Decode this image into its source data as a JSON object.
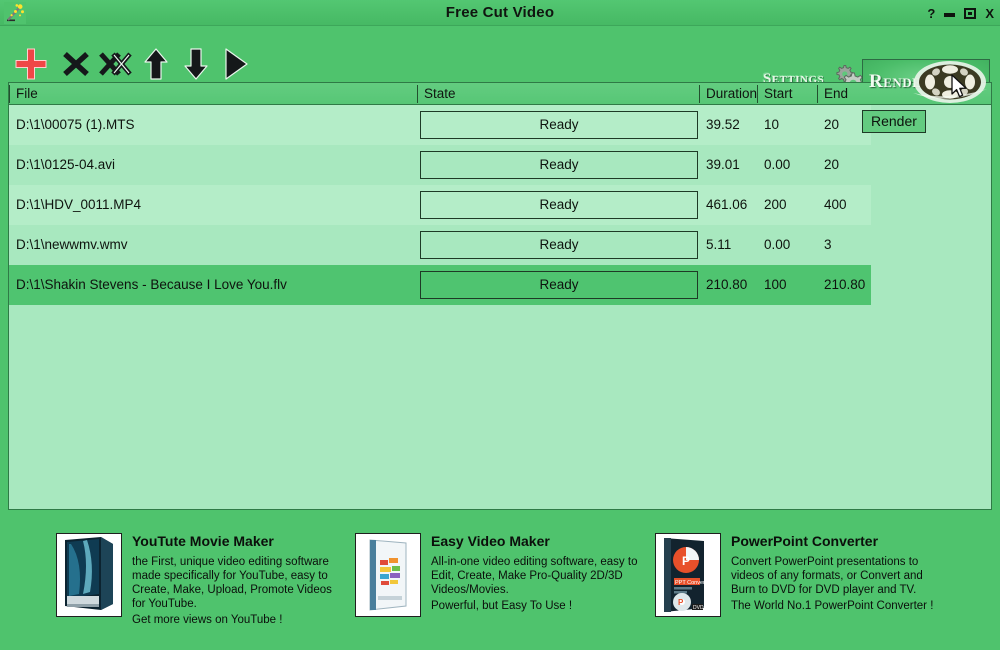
{
  "window": {
    "title": "Free Cut Video",
    "app_icon": "magic-wand-icon",
    "controls": {
      "help": "?",
      "minimize": "minimize",
      "maximize": "maximize",
      "close": "X"
    }
  },
  "toolbar": {
    "items": [
      {
        "name": "add-file-button",
        "icon": "plus-icon",
        "tip": "Add"
      },
      {
        "name": "remove-file-button",
        "icon": "close-x-icon",
        "tip": "Remove"
      },
      {
        "name": "remove-all-button",
        "icon": "double-x-icon",
        "tip": "Remove All"
      },
      {
        "name": "move-up-button",
        "icon": "arrow-up-icon",
        "tip": "Move Up"
      },
      {
        "name": "move-down-button",
        "icon": "arrow-down-icon",
        "tip": "Move Down"
      },
      {
        "name": "play-button",
        "icon": "play-triangle-icon",
        "tip": "Play"
      }
    ],
    "settings_label": "Settings",
    "render_label": "Render",
    "render_tooltip": "Render"
  },
  "list": {
    "columns": [
      {
        "key": "file",
        "label": "File"
      },
      {
        "key": "state",
        "label": "State"
      },
      {
        "key": "duration",
        "label": "Duration"
      },
      {
        "key": "start",
        "label": "Start"
      },
      {
        "key": "end",
        "label": "End"
      }
    ],
    "rows": [
      {
        "file": "D:\\1\\00075 (1).MTS",
        "state": "Ready",
        "duration": "39.52",
        "start": "10",
        "end": "20",
        "selected": false
      },
      {
        "file": "D:\\1\\0125-04.avi",
        "state": "Ready",
        "duration": "39.01",
        "start": "0.00",
        "end": "20",
        "selected": false
      },
      {
        "file": "D:\\1\\HDV_0011.MP4",
        "state": "Ready",
        "duration": "461.06",
        "start": "200",
        "end": "400",
        "selected": false
      },
      {
        "file": "D:\\1\\newwmv.wmv",
        "state": "Ready",
        "duration": "5.11",
        "start": "0.00",
        "end": "3",
        "selected": false
      },
      {
        "file": "D:\\1\\Shakin Stevens - Because I Love You.flv",
        "state": "Ready",
        "duration": "210.80",
        "start": "100",
        "end": "210.80",
        "selected": true
      }
    ]
  },
  "ads": [
    {
      "title": "YouTute Movie Maker",
      "desc": "the First, unique video editing software\nmade specifically for YouTube, easy to\nCreate, Make, Upload, Promote Videos\nfor YouTube.",
      "footer": "Get more views on YouTube !",
      "box_icon": "youtube-movie-maker-box-icon"
    },
    {
      "title": "Easy Video Maker",
      "desc": "All-in-one video editing software, easy to\nEdit, Create, Make Pro-Quality 2D/3D\nVideos/Movies.",
      "footer": "Powerful, but Easy To Use !",
      "box_icon": "easy-video-maker-box-icon"
    },
    {
      "title": "PowerPoint Converter",
      "desc": "Convert PowerPoint presentations to\nvideos of any formats, or Convert and\nBurn to DVD for DVD player and TV.",
      "footer": "The World No.1 PowerPoint Converter !",
      "box_icon": "powerpoint-converter-box-icon"
    }
  ],
  "colors": {
    "window_green": "#4fc36d",
    "list_bg": "#a8e8bf",
    "row_alt": "#b4edc8",
    "row_selected": "#4fc470",
    "header_green": "#5ec97a",
    "add_icon_red": "#f04646",
    "border_dark": "#2f7a46"
  }
}
